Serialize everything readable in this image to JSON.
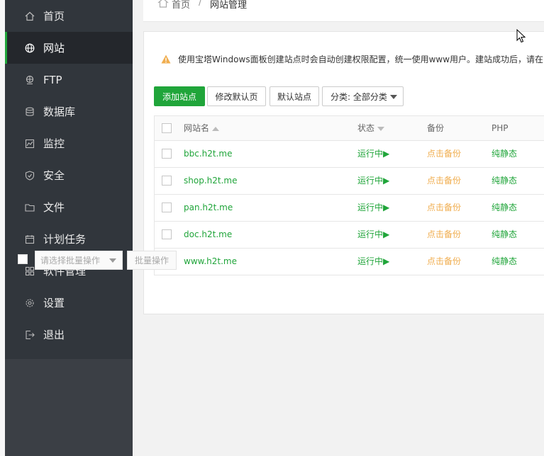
{
  "sidebar": {
    "items": [
      {
        "label": "首页",
        "icon": "home-icon",
        "active": false
      },
      {
        "label": "网站",
        "icon": "globe-icon",
        "active": true
      },
      {
        "label": "FTP",
        "icon": "ftp-icon",
        "active": false
      },
      {
        "label": "数据库",
        "icon": "database-icon",
        "active": false
      },
      {
        "label": "监控",
        "icon": "monitor-icon",
        "active": false
      },
      {
        "label": "安全",
        "icon": "shield-icon",
        "active": false
      },
      {
        "label": "文件",
        "icon": "folder-icon",
        "active": false
      },
      {
        "label": "计划任务",
        "icon": "calendar-icon",
        "active": false
      },
      {
        "label": "软件管理",
        "icon": "grid-icon",
        "active": false
      },
      {
        "label": "设置",
        "icon": "gear-icon",
        "active": false
      },
      {
        "label": "退出",
        "icon": "logout-icon",
        "active": false
      }
    ]
  },
  "breadcrumb": {
    "home": "首页",
    "separator": "/",
    "current": "网站管理"
  },
  "notice": {
    "text": "使用宝塔Windows面板创建站点时会自动创建权限配置，统一使用www用户。建站成功后，请在"
  },
  "toolbar": {
    "add_site": "添加站点",
    "modify_default_page": "修改默认页",
    "default_site": "默认站点",
    "category": "分类: 全部分类"
  },
  "table": {
    "headers": {
      "name": "网站名",
      "status": "状态",
      "backup": "备份",
      "php": "PHP"
    },
    "rows": [
      {
        "name": "bbc.h2t.me",
        "status": "运行中▶",
        "backup": "点击备份",
        "php": "纯静态"
      },
      {
        "name": "shop.h2t.me",
        "status": "运行中▶",
        "backup": "点击备份",
        "php": "纯静态"
      },
      {
        "name": "pan.h2t.me",
        "status": "运行中▶",
        "backup": "点击备份",
        "php": "纯静态"
      },
      {
        "name": "doc.h2t.me",
        "status": "运行中▶",
        "backup": "点击备份",
        "php": "纯静态"
      },
      {
        "name": "www.h2t.me",
        "status": "运行中▶",
        "backup": "点击备份",
        "php": "纯静态"
      }
    ]
  },
  "batch": {
    "select_placeholder": "请选择批量操作",
    "button": "批量操作"
  },
  "colors": {
    "accent": "#20a53a",
    "backup_link": "#f0ad4e",
    "sidebar": "#31363c",
    "warning": "#f0ad4e"
  }
}
